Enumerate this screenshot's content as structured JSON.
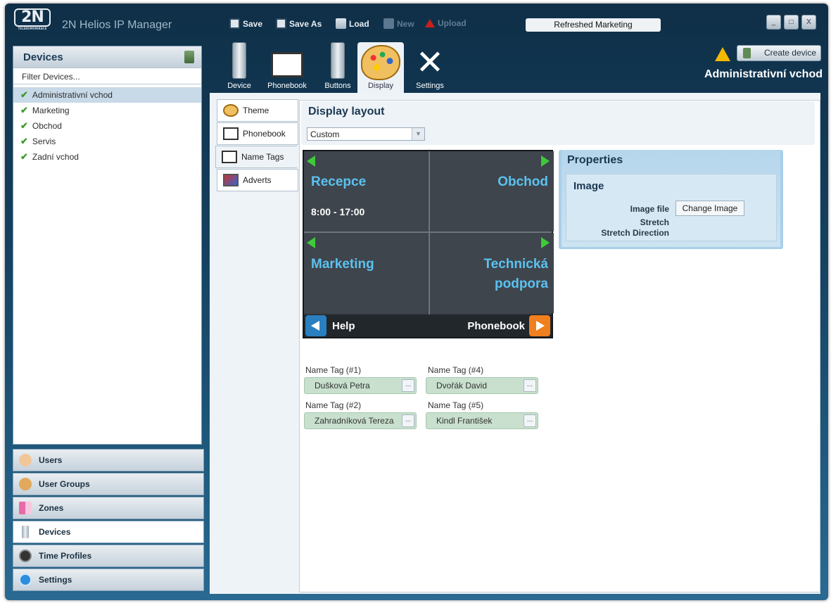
{
  "app": {
    "logo_text": "2N",
    "logo_sub": "TELEKOMUNIKACE",
    "title": "2N Helios IP Manager"
  },
  "toolbar": {
    "save": "Save",
    "save_as": "Save As",
    "load": "Load",
    "new": "New",
    "upload": "Upload",
    "config_name": "Refreshed Marketing"
  },
  "window": {
    "minimize": "_",
    "maximize": "□",
    "close": "X"
  },
  "devices_panel": {
    "title": "Devices",
    "filter_placeholder": "Filter Devices...",
    "items": [
      {
        "label": "Administrativní vchod",
        "selected": true
      },
      {
        "label": "Marketing"
      },
      {
        "label": "Obchod"
      },
      {
        "label": "Servis"
      },
      {
        "label": "Zadní vchod"
      }
    ]
  },
  "nav": {
    "users": "Users",
    "user_groups": "User Groups",
    "zones": "Zones",
    "devices": "Devices",
    "time_profiles": "Time Profiles",
    "settings": "Settings",
    "active": "Devices"
  },
  "top_tabs": {
    "device": "Device",
    "phonebook": "Phonebook",
    "buttons": "Buttons",
    "display": "Display",
    "settings": "Settings",
    "active": "Display"
  },
  "header": {
    "create_device": "Create device",
    "device_title": "Administrativní vchod"
  },
  "sub_tabs": {
    "theme": "Theme",
    "phonebook": "Phonebook",
    "name_tags": "Name Tags",
    "adverts": "Adverts",
    "active": "Name Tags"
  },
  "display_layout": {
    "title": "Display layout",
    "selected": "Custom"
  },
  "preview": {
    "cells": [
      {
        "name": "Recepce",
        "sub": "8:00 - 17:00"
      },
      {
        "name": "Obchod"
      },
      {
        "name": "Marketing"
      },
      {
        "name_line1": "Technická",
        "name_line2": "podpora"
      }
    ],
    "help": "Help",
    "phonebook": "Phonebook"
  },
  "properties": {
    "title": "Properties",
    "section": "Image",
    "image_file_label": "Image file",
    "change_image": "Change Image",
    "stretch_label": "Stretch",
    "stretch_direction_label": "Stretch Direction"
  },
  "name_tags": [
    {
      "label": "Name Tag (#1)",
      "value": "Dušková Petra"
    },
    {
      "label": "Name Tag (#4)",
      "value": "Dvořák David"
    },
    {
      "label": "Name Tag (#2)",
      "value": "Zahradníková Tereza"
    },
    {
      "label": "Name Tag (#5)",
      "value": "Kindl František"
    }
  ],
  "colors": {
    "accent": "#5bc2f0",
    "frame": "#15405f",
    "ok_check": "#3d9c2c"
  }
}
